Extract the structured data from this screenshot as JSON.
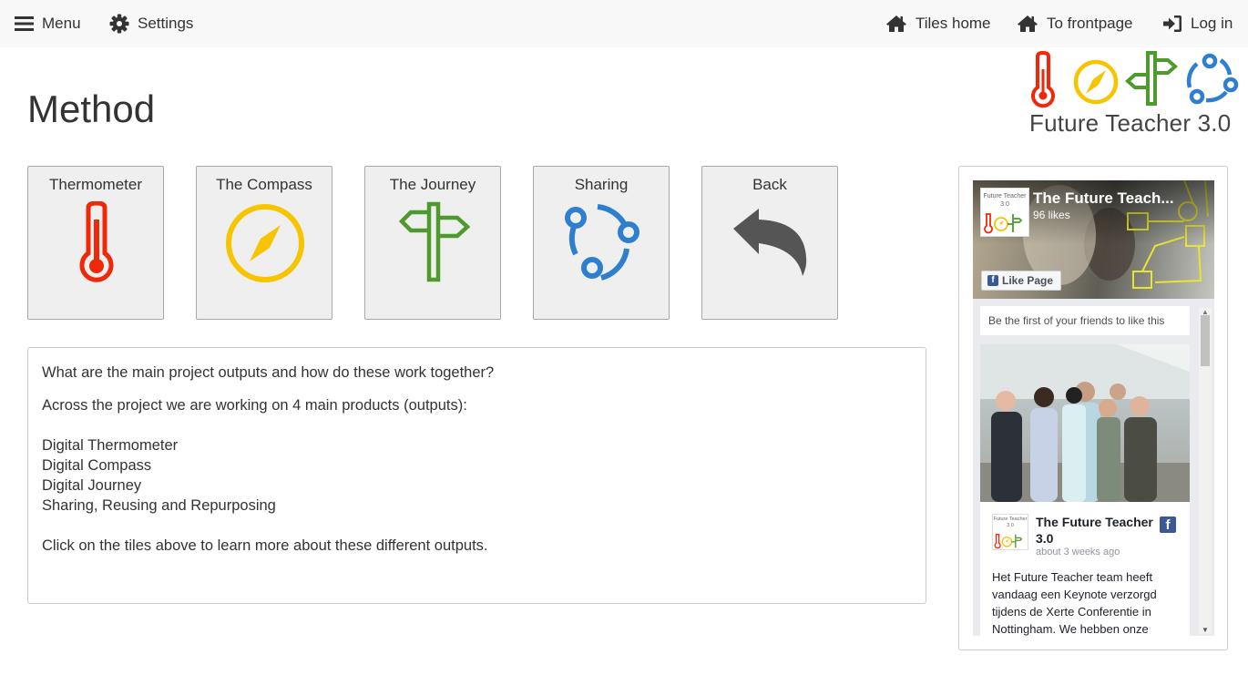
{
  "nav": {
    "menu_label": "Menu",
    "settings_label": "Settings",
    "tiles_home_label": "Tiles home",
    "frontpage_label": "To frontpage",
    "login_label": "Log in"
  },
  "logo": {
    "text": "Future Teacher 3.0"
  },
  "page": {
    "title": "Method"
  },
  "tiles": [
    {
      "label": "Thermometer",
      "icon": "thermometer-icon",
      "color": "#f0280a"
    },
    {
      "label": "The Compass",
      "icon": "compass-icon",
      "color": "#f7c400"
    },
    {
      "label": "The Journey",
      "icon": "signpost-icon",
      "color": "#4e9a2c"
    },
    {
      "label": "Sharing",
      "icon": "sharing-icon",
      "color": "#2f7fd0"
    },
    {
      "label": "Back",
      "icon": "back-arrow-icon",
      "color": "#555555"
    }
  ],
  "content": {
    "question": "What are the main project outputs and how do these work together?",
    "intro": "Across the project we are working on 4 main products (outputs):",
    "outputs": [
      "Digital Thermometer",
      "Digital Compass",
      "Digital Journey",
      "Sharing, Reusing and Repurposing"
    ],
    "outro": "Click on the tiles above to learn more about these different outputs."
  },
  "facebook": {
    "page_name": "The Future Teach...",
    "likes": "96 likes",
    "like_button": "Like Page",
    "thumb_text": "Future Teacher 3.0",
    "first_friends": "Be the first of your friends to like this",
    "post": {
      "author": "The Future Teacher 3.0",
      "date": "about 3 weeks ago",
      "text": "Het Future Teacher team heeft vandaag een Keynote verzorgd tijdens de Xerte Conferentie in Nottingham. We hebben onze"
    }
  }
}
